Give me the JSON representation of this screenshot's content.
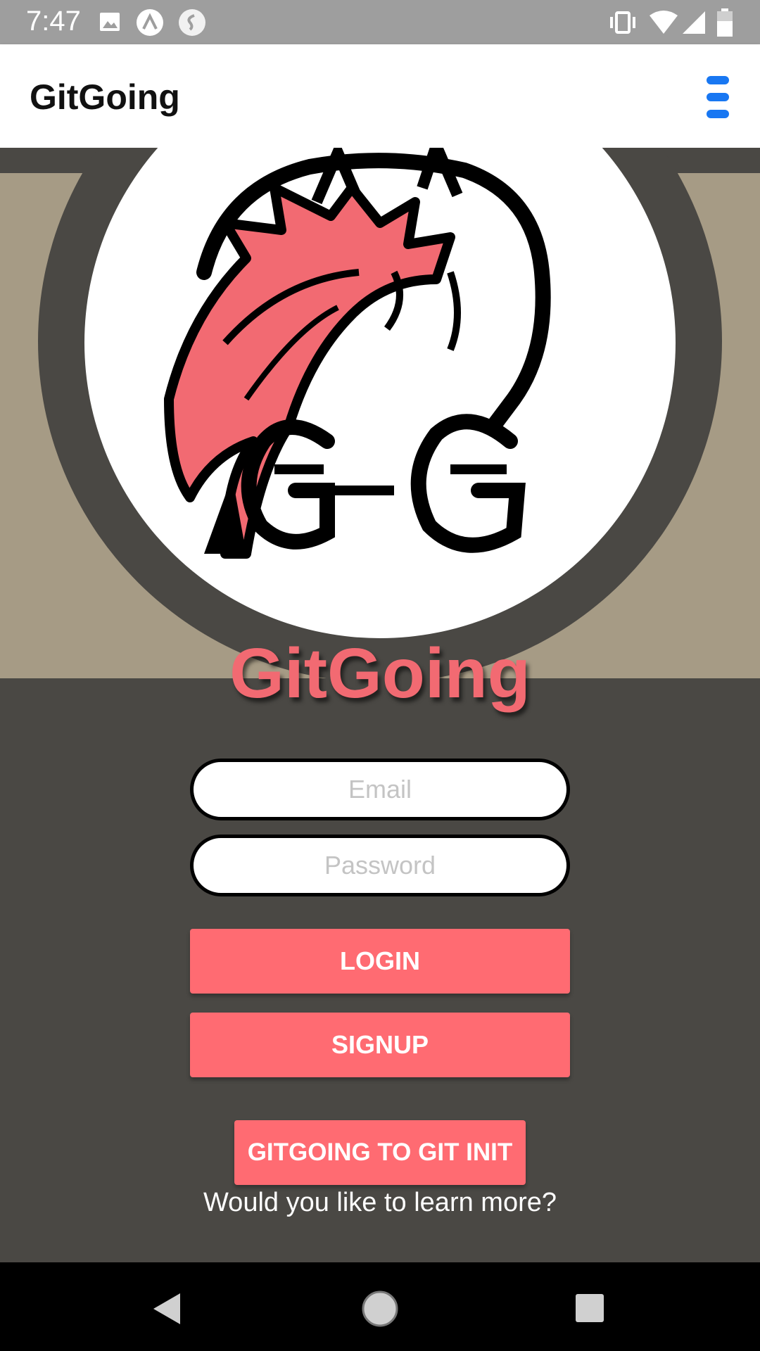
{
  "status_bar": {
    "time": "7:47"
  },
  "app_bar": {
    "title": "GitGoing"
  },
  "brand": {
    "title": "GitGoing"
  },
  "form": {
    "email_placeholder": "Email",
    "password_placeholder": "Password",
    "login_label": "LOGIN",
    "signup_label": "SIGNUP"
  },
  "intro": {
    "button_label": "GITGOING TO GIT INIT",
    "caption": "Would you like to learn more?"
  },
  "colors": {
    "accent": "#ff6b72",
    "menu_icon": "#1877f2",
    "background": "#4a4844",
    "hero_tan": "#a69b85"
  }
}
